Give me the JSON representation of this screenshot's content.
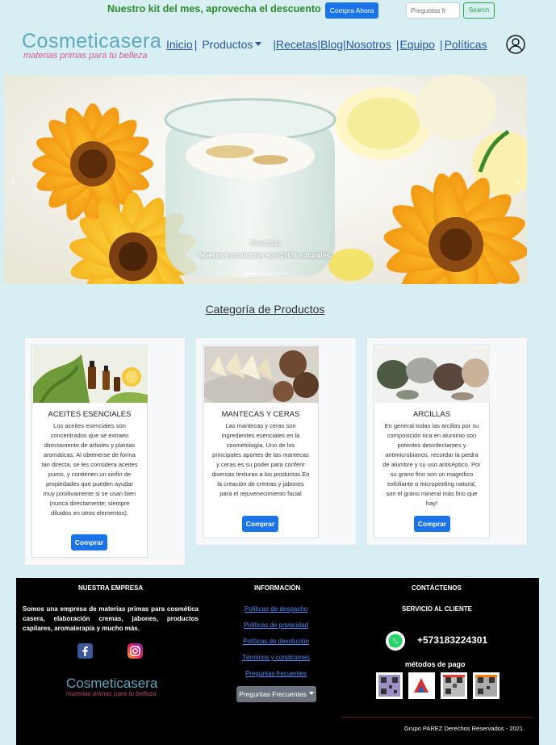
{
  "topbar": {
    "promo_text": "Nuestro kit del mes, aprovecha el descuento",
    "buy_button": "Compra Ahora",
    "search_placeholder": "Preguntas fr",
    "search_button": "Search"
  },
  "brand": {
    "name": "Cosmeticasera",
    "tagline": "materias primas para tu belleza"
  },
  "nav": {
    "inicio": "Inicio",
    "productos": "Productos",
    "recetas": "Recetas",
    "blog": "Blog",
    "nosotros": "Nosotros",
    "equipo": "Equipo",
    "politicas": "Políticas"
  },
  "hero": {
    "caption_title": "Esencias",
    "caption_text": "Nuestros productos son 100% naturales.",
    "slides": 3,
    "active_slide": 1
  },
  "category": {
    "title": "Categoría de Productos",
    "cards": [
      {
        "title": "ACEITES ESENCIALES",
        "text": "Los aceites esenciales son concentrados que se extraen directamente de árboles y plantas aromáticas. Al obtenerse de forma tan directa, se les considera aceites puros, y contienen un sinfín de propiedades que pueden ayudar muy positivamente si se usan bien (nunca directamente; siempre diluidos en otros elementos).",
        "button": "Comprar"
      },
      {
        "title": "MANTECAS Y CERAS",
        "text": "Las mantecas y ceras son ingredientes esenciales en la cosmetología. Uno de los principales aportes de las mantecas y ceras es su poder para conferir diversas texturas a los productos.En la creación de cremas y jabones para el rejuvenecimiento facial",
        "button": "Comprar"
      },
      {
        "title": "ARCILLAS",
        "text": "En general todas las arcillas por su composición rica en aluminio son potentes desinfectantes y antimicrobianos, recordar la piedra de alumbre y su uso antiséptico. Por su grano fino son un magnífico exfoliante o micropeeling natural, son el grano mineral más fino que hay!",
        "button": "Comprar"
      }
    ]
  },
  "footer": {
    "col1_title": "NUESTRA EMPRESA",
    "col1_text": "Somos una empresa de materias primas para cosmética casera, elaboración cremas, jabones, productos capilares, aromaterapia y mucho más.",
    "col2_title": "INFORMACIÓN",
    "links": [
      "Políticas de despacho",
      "Políticas de privacidad",
      "Políticas de devolución",
      "Términos y condiciones",
      "Preguntas frecuentes"
    ],
    "dropdown": "Preguntas Frecuentes",
    "col3_title": "CONTÁCTENOS",
    "service": "SERVICIO AL CLIENTE",
    "phone": "+573183224301",
    "payment_title": "métodos de pago",
    "copyright": "Grupo PAREZ Derechos Reservados - 2021.",
    "logo_name": "Cosmeticasera",
    "logo_tagline": "materias primas para tu belleza"
  },
  "colors": {
    "background": "#d7eef2",
    "primary": "#1a73e8",
    "nav_link": "#2a55a5",
    "promo": "#2e8a2e"
  }
}
